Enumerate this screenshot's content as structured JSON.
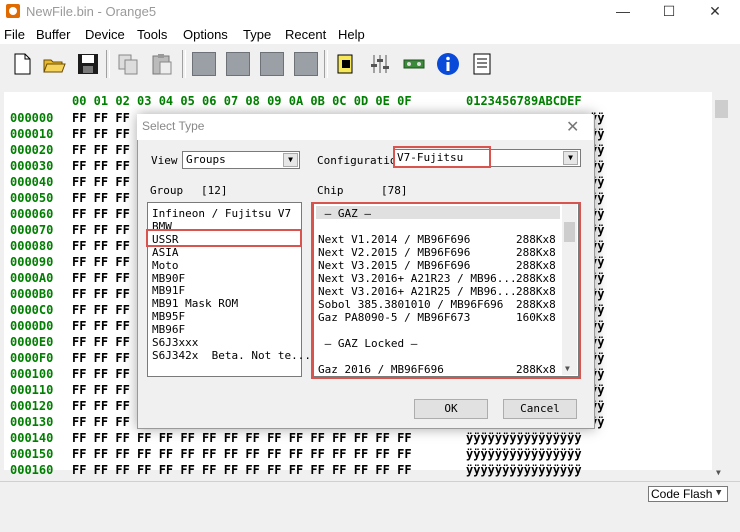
{
  "window": {
    "title": "NewFile.bin - Orange5",
    "minimize": "—",
    "maximize": "☐",
    "close": "✕"
  },
  "menu": [
    "File",
    "Buffer",
    "Device",
    "Tools",
    "Options",
    "Type",
    "Recent",
    "Help"
  ],
  "toolbar": [
    "new-file-icon",
    "open-folder-icon",
    "save-icon",
    "copy-icon",
    "paste-icon",
    "chip-icon",
    "chip-icon",
    "chip-icon",
    "chip-icon",
    "chip-icon",
    "settings-icon",
    "equalizer-icon",
    "device-icon",
    "info-icon",
    "notepad-icon"
  ],
  "hex": {
    "header": "00 01 02 03 04 05 06 07 08 09 0A 0B 0C 0D 0E 0F",
    "ascii_header": "0123456789ABCDEF",
    "addresses": [
      "000000",
      "000010",
      "000020",
      "000030",
      "000040",
      "000050",
      "000060",
      "000070",
      "000080",
      "000090",
      "0000A0",
      "0000B0",
      "0000C0",
      "0000D0",
      "0000E0",
      "0000F0",
      "000100",
      "000110",
      "000120",
      "000130",
      "000140",
      "000150",
      "000160"
    ],
    "left_fill": "FF FF FF",
    "full_fill": "FF FF FF FF FF FF FF FF FF FF FF FF FF FF FF FF",
    "ascii_fill": "ÿÿ",
    "full_ascii": "ÿÿÿÿÿÿÿÿÿÿÿÿÿÿÿÿ"
  },
  "status": {
    "code_flash": "Code Flash"
  },
  "dialog": {
    "title": "Select Type",
    "close": "✕",
    "view_label": "View",
    "view_value": "Groups",
    "config_label": "Configuratio",
    "config_value": "V7-Fujitsu",
    "group_label": "Group",
    "group_count": "[12]",
    "chip_label": "Chip",
    "chip_count": "[78]",
    "groups": [
      "Infineon / Fujitsu V7",
      "BMW",
      "USSR",
      "ASIA",
      "Moto",
      "MB90F",
      "MB91F",
      "MB91 Mask ROM",
      "MB95F",
      "MB96F",
      "S6J3xxx",
      "S6J342x  Beta. Not te..."
    ],
    "chips": [
      {
        "name": " — GAZ —",
        "size": ""
      },
      {
        "name": "",
        "size": ""
      },
      {
        "name": "Next V1.2014 / MB96F696",
        "size": "288Kx8"
      },
      {
        "name": "Next V2.2015 / MB96F696",
        "size": "288Kx8"
      },
      {
        "name": "Next V3.2015 / MB96F696",
        "size": "288Kx8"
      },
      {
        "name": "Next V3.2016+ A21R23 / MB96...",
        "size": "288Kx8"
      },
      {
        "name": "Next V3.2016+ A21R25 / MB96...",
        "size": "288Kx8"
      },
      {
        "name": "Sobol 385.3801010 / MB96F696",
        "size": "288Kx8"
      },
      {
        "name": "Gaz PA8090-5 / MB96F673",
        "size": "160Kx8"
      },
      {
        "name": "",
        "size": ""
      },
      {
        "name": " — GAZ Locked —",
        "size": ""
      },
      {
        "name": "",
        "size": ""
      },
      {
        "name": "Gaz 2016 / MB96F696",
        "size": "288Kx8"
      }
    ],
    "ok": "OK",
    "cancel": "Cancel"
  }
}
